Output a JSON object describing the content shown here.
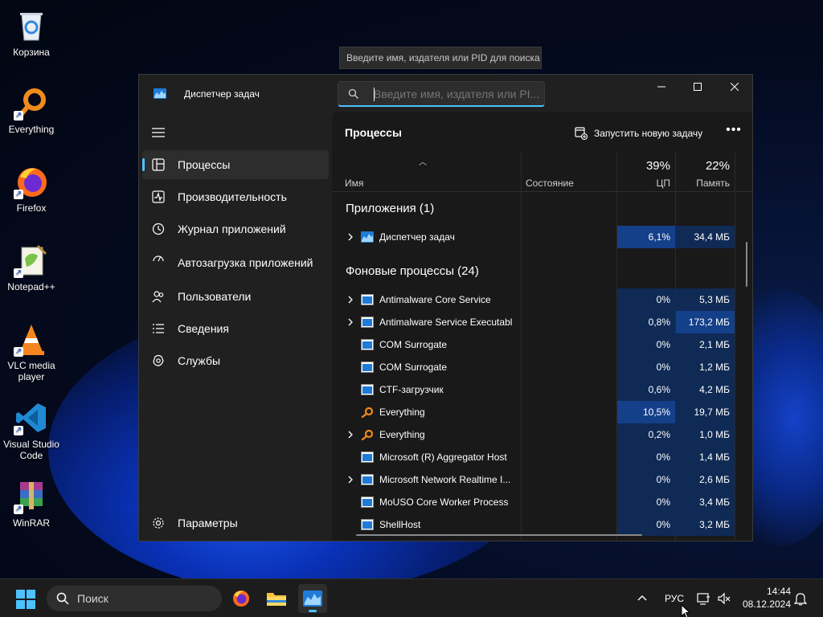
{
  "desktop": {
    "icons": [
      {
        "label": "Корзина"
      },
      {
        "label": "Everything"
      },
      {
        "label": "Firefox"
      },
      {
        "label": "Notepad++"
      },
      {
        "label": "VLC media player"
      },
      {
        "label": "Visual Studio Code"
      },
      {
        "label": "WinRAR"
      }
    ]
  },
  "tooltip": {
    "text": "Введите имя, издателя или PID для поиска"
  },
  "window": {
    "title": "Диспетчер задач",
    "search_placeholder": "Введите имя, издателя или PID для поиска",
    "search_display": "Введите имя, издателя или PI..."
  },
  "sidebar": {
    "items": [
      {
        "label": "Процессы",
        "icon": "processes-icon",
        "selected": true
      },
      {
        "label": "Производительность",
        "icon": "performance-icon"
      },
      {
        "label": "Журнал приложений",
        "icon": "app-history-icon"
      },
      {
        "label": "Автозагрузка приложений",
        "icon": "startup-icon"
      },
      {
        "label": "Пользователи",
        "icon": "users-icon"
      },
      {
        "label": "Сведения",
        "icon": "details-icon"
      },
      {
        "label": "Службы",
        "icon": "services-icon"
      }
    ],
    "settings_label": "Параметры"
  },
  "main": {
    "title": "Процессы",
    "run_task_label": "Запустить новую задачу",
    "more_label": "•••",
    "columns": {
      "name": "Имя",
      "status": "Состояние",
      "cpu_pct": "39%",
      "cpu": "ЦП",
      "mem_pct": "22%",
      "mem": "Память"
    },
    "groups": [
      {
        "title": "Приложения (1)",
        "rows": [
          {
            "name": "Диспетчер задач",
            "cpu": "6,1%",
            "mem": "34,4 МБ",
            "expand": true,
            "icon": "taskmgr",
            "cpu_level": 2,
            "mem_level": 1
          }
        ]
      },
      {
        "title": "Фоновые процессы (24)",
        "rows": [
          {
            "name": "Antimalware Core Service",
            "cpu": "0%",
            "mem": "5,3 МБ",
            "expand": true,
            "icon": "window",
            "cpu_level": 1,
            "mem_level": 1
          },
          {
            "name": "Antimalware Service Executable",
            "cpu": "0,8%",
            "mem": "173,2 МБ",
            "expand": true,
            "icon": "window",
            "cpu_level": 1,
            "mem_level": 2
          },
          {
            "name": "COM Surrogate",
            "cpu": "0%",
            "mem": "2,1 МБ",
            "expand": false,
            "icon": "window",
            "cpu_level": 1,
            "mem_level": 1
          },
          {
            "name": "COM Surrogate",
            "cpu": "0%",
            "mem": "1,2 МБ",
            "expand": false,
            "icon": "window",
            "cpu_level": 1,
            "mem_level": 1
          },
          {
            "name": "CTF-загрузчик",
            "cpu": "0,6%",
            "mem": "4,2 МБ",
            "expand": false,
            "icon": "window",
            "cpu_level": 1,
            "mem_level": 1
          },
          {
            "name": "Everything",
            "cpu": "10,5%",
            "mem": "19,7 МБ",
            "expand": false,
            "icon": "everything",
            "cpu_level": 2,
            "mem_level": 1
          },
          {
            "name": "Everything",
            "cpu": "0,2%",
            "mem": "1,0 МБ",
            "expand": true,
            "icon": "everything",
            "cpu_level": 1,
            "mem_level": 1
          },
          {
            "name": "Microsoft (R) Aggregator Host",
            "cpu": "0%",
            "mem": "1,4 МБ",
            "expand": false,
            "icon": "window",
            "cpu_level": 1,
            "mem_level": 1
          },
          {
            "name": "Microsoft Network Realtime I...",
            "cpu": "0%",
            "mem": "2,6 МБ",
            "expand": true,
            "icon": "window",
            "cpu_level": 1,
            "mem_level": 1
          },
          {
            "name": "MoUSO Core Worker Process",
            "cpu": "0%",
            "mem": "3,4 МБ",
            "expand": false,
            "icon": "window",
            "cpu_level": 1,
            "mem_level": 1
          },
          {
            "name": "ShellHost",
            "cpu": "0%",
            "mem": "3,2 МБ",
            "expand": false,
            "icon": "window",
            "cpu_level": 1,
            "mem_level": 1
          }
        ]
      }
    ]
  },
  "taskbar": {
    "search_label": "Поиск",
    "lang": "РУС",
    "time": "14:44",
    "date": "08.12.2024",
    "apps": [
      "firefox-icon",
      "file-explorer-icon",
      "task-manager-icon"
    ]
  },
  "colors": {
    "accent": "#4cc2ff",
    "heat_low": "#0f2a55",
    "heat_high": "#14408a"
  }
}
